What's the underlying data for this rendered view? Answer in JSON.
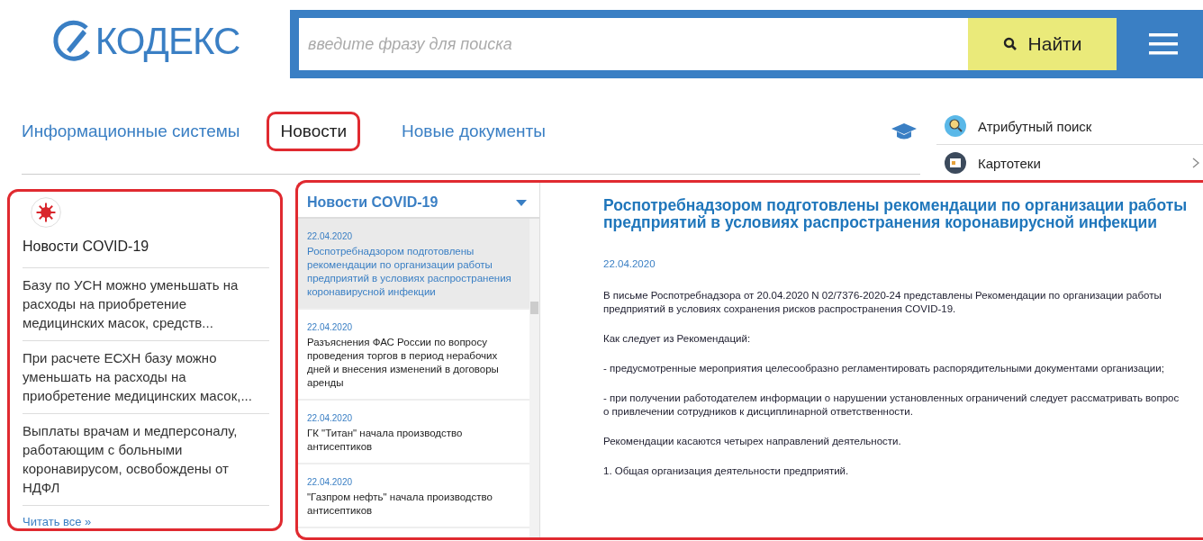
{
  "logo": {
    "text": "КОДЕКС"
  },
  "search": {
    "placeholder": "введите фразу для поиска",
    "button": "Найти"
  },
  "nav": [
    {
      "label": "Информационные системы",
      "selected": false
    },
    {
      "label": "Новости",
      "selected": true
    },
    {
      "label": "Новые документы",
      "selected": false
    }
  ],
  "side_links": [
    {
      "label": "Атрибутный поиск",
      "kind": "search",
      "arrow": false
    },
    {
      "label": "Картотеки",
      "kind": "cards",
      "arrow": true
    }
  ],
  "covid_panel": {
    "title": "Новости COVID-19",
    "items": [
      "Базу по УСН можно уменьшать на расходы на приобретение медицинских масок, средств...",
      "При расчете ЕСХН базу можно уменьшать на расходы на приобретение медицинских масок,...",
      "Выплаты врачам и медперсоналу, работающим с больными коронавирусом, освобождены от НДФЛ"
    ],
    "more": "Читать все »"
  },
  "news_list": {
    "title": "Новости COVID-19",
    "items": [
      {
        "date": "22.04.2020",
        "text": "Роспотребнадзором подготовлены рекомендации по организации работы предприятий в условиях распространения коронавирусной инфекции",
        "selected": true
      },
      {
        "date": "22.04.2020",
        "text": "Разъяснения ФАС России по вопросу проведения торгов в период нерабочих дней и внесения изменений в договоры аренды",
        "selected": false
      },
      {
        "date": "22.04.2020",
        "text": "ГК \"Титан\" начала производство антисептиков",
        "selected": false
      },
      {
        "date": "22.04.2020",
        "text": "\"Газпром нефть\" начала производство антисептиков",
        "selected": false
      }
    ]
  },
  "article": {
    "title": "Роспотребнадзором подготовлены рекомендации по организации работы предприятий в условиях распространения коронавирусной инфекции",
    "date": "22.04.2020",
    "paragraphs": [
      "В письме Роспотребнадзора от 20.04.2020 N 02/7376-2020-24 представлены Рекомендации по организации работы предприятий в условиях сохранения рисков распространения COVID-19.",
      "Как следует из Рекомендаций:",
      "- предусмотренные мероприятия целесообразно регламентировать распорядительными документами организации;",
      "- при получении работодателем информации о нарушении установленных ограничений следует рассматривать вопрос о привлечении сотрудников к дисциплинарной ответственности.",
      "Рекомендации касаются четырех направлений деятельности.",
      "1. Общая организация деятельности предприятий."
    ]
  }
}
